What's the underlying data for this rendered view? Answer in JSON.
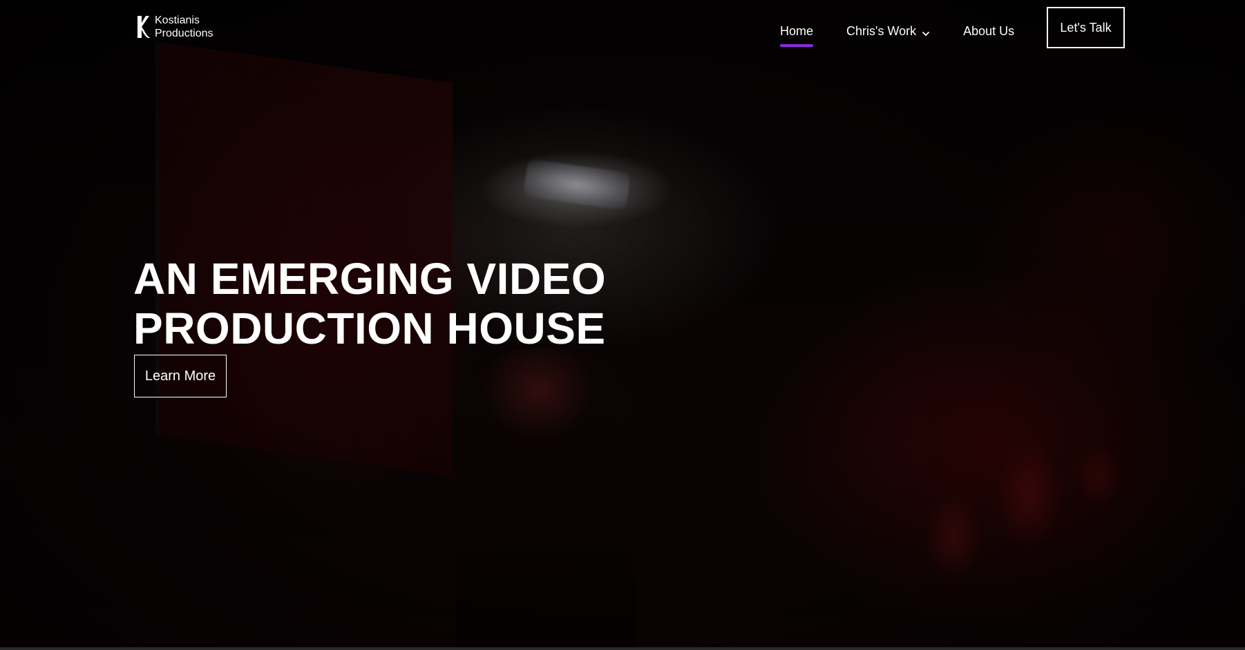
{
  "brand": {
    "line1": "Kostianis",
    "line2": "Productions"
  },
  "nav": {
    "items": [
      {
        "label": "Home",
        "active": true
      },
      {
        "label": "Chris's Work",
        "dropdown": true
      },
      {
        "label": "About Us"
      }
    ],
    "cta_label": "Let's Talk",
    "active_color": "#8a2be2"
  },
  "hero": {
    "title_line1": "AN EMERGING VIDEO",
    "title_line2": "PRODUCTION HOUSE",
    "button_label": "Learn More",
    "background": "dark concert stage video with red lighting"
  },
  "icons": {
    "dropdown": "chevron-down-icon",
    "logo": "k-logo-icon"
  }
}
